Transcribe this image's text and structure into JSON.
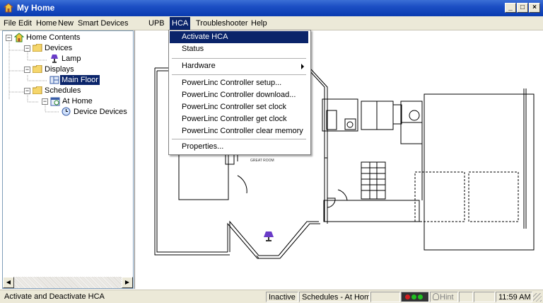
{
  "window": {
    "title": "My Home"
  },
  "menubar": {
    "items": [
      "File",
      "Edit",
      "Home",
      "New",
      "Smart Devices",
      "UPB",
      "HCA",
      "Troubleshooter",
      "Help"
    ],
    "active": "HCA"
  },
  "tree": {
    "root": "Home Contents",
    "nodes": {
      "devices": "Devices",
      "lamp": "Lamp",
      "displays": "Displays",
      "main_floor": "Main Floor",
      "schedules": "Schedules",
      "at_home": "At Home",
      "device_devices": "Device Devices"
    },
    "selected": "Main Floor"
  },
  "hca_menu": {
    "activate": "Activate HCA",
    "status": "Status",
    "hardware": "Hardware",
    "plc_setup": "PowerLinc Controller setup...",
    "plc_download": "PowerLinc Controller download...",
    "plc_set_clock": "PowerLinc Controller set clock",
    "plc_get_clock": "PowerLinc Controller get clock",
    "plc_clear_memory": "PowerLinc Controller clear memory",
    "properties": "Properties..."
  },
  "floorplan": {
    "room_label": "GREAT ROOM",
    "lamp_icon": "lamp-icon"
  },
  "statusbar": {
    "message": "Activate and Deactivate HCA",
    "state": "Inactive",
    "schedule": "Schedules - At Home",
    "hint": "Hint",
    "time": "11:59 AM"
  },
  "colors": {
    "titlebar": "#0a3bb0",
    "menu_highlight": "#0a246a",
    "chrome": "#ece9d8",
    "lamp_purple": "#6a3cc8"
  }
}
